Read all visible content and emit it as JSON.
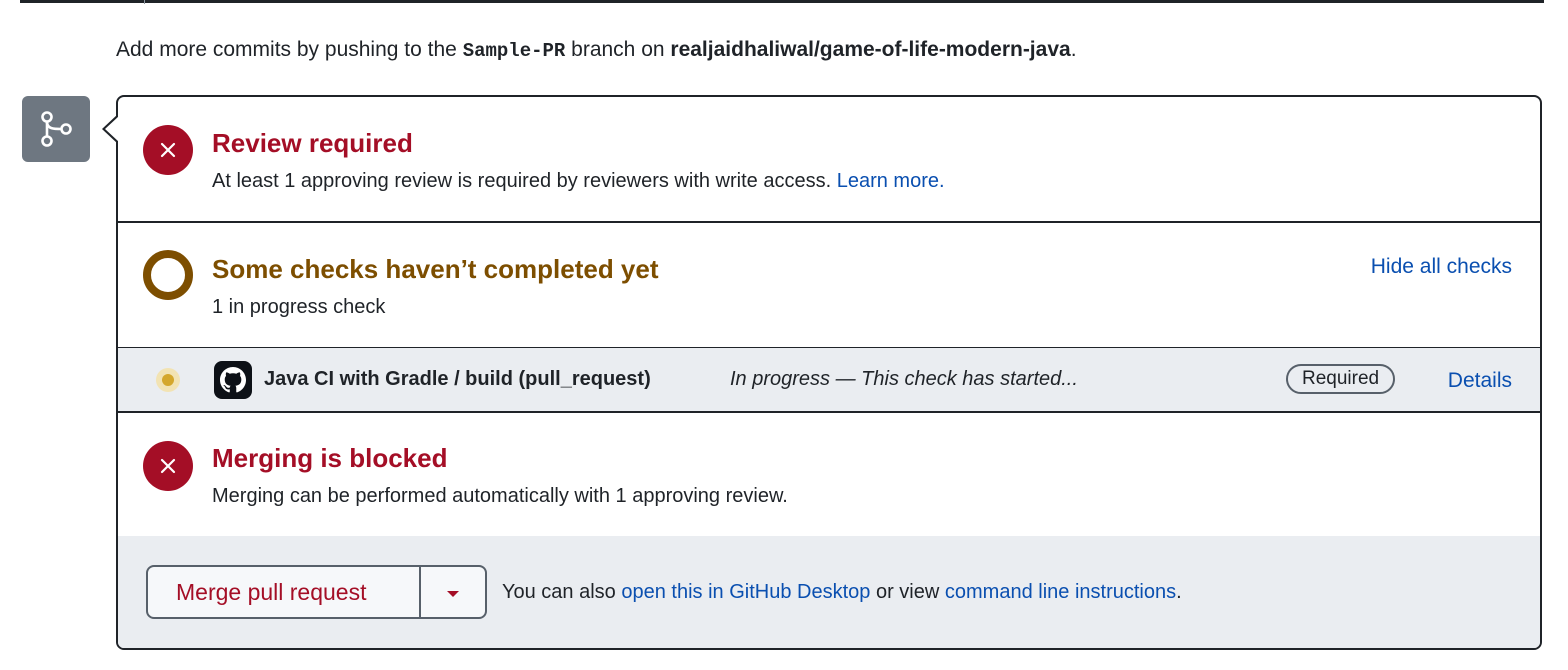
{
  "push_note": {
    "prefix": "Add more commits by pushing to the",
    "branch": "Sample-PR",
    "middle": "branch on",
    "repo": "realjaidhaliwal/game-of-life-modern-java",
    "suffix": "."
  },
  "review": {
    "title": "Review required",
    "description": "At least 1 approving review is required by reviewers with write access.",
    "link": "Learn more."
  },
  "checks": {
    "title": "Some checks haven’t completed yet",
    "summary": "1 in progress check",
    "toggle": "Hide all checks",
    "items": [
      {
        "name": "Java CI with Gradle / build (pull_request)",
        "status": "In progress — This check has started...",
        "badge": "Required",
        "details": "Details"
      }
    ]
  },
  "merge_status": {
    "title": "Merging is blocked",
    "description": "Merging can be performed automatically with 1 approving review."
  },
  "footer": {
    "merge_button": "Merge pull request",
    "note_prefix": "You can also",
    "desktop_link": "open this in GitHub Desktop",
    "note_middle": "or view",
    "cli_link": "command line instructions",
    "note_suffix": "."
  },
  "colors": {
    "danger": "#a40e26",
    "pending": "#7d4e00",
    "link": "#0a4fb0",
    "badge_bg": "#6e7781",
    "panel_bg": "#eaedf1"
  },
  "icons": {
    "branch_badge": "git-pull-request-icon",
    "review": "x-circle-icon",
    "checks": "pending-ring-icon",
    "check_item": "pending-dot-icon",
    "app": "github-mark-icon",
    "merge_blocked": "x-circle-icon",
    "merge_dropdown": "triangle-down-icon"
  }
}
